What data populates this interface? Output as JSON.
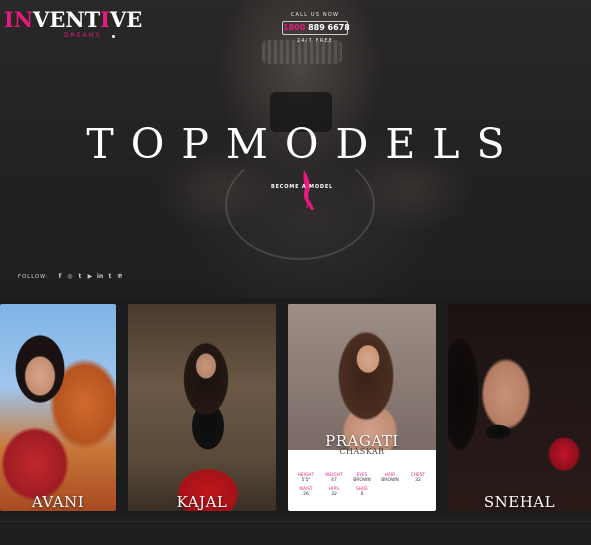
{
  "brand": {
    "name_prefix": "IN",
    "name_rest": "VENT",
    "name_i": "I",
    "name_end": "VE",
    "tagline": "DREAMS"
  },
  "contact": {
    "call_label": "CALL US NOW",
    "phone_prefix": "1800",
    "phone_number": "889 6678",
    "availability": "24/7 FREE"
  },
  "hero": {
    "title": "TOPMODELS",
    "cta": "BECOME A MODEL"
  },
  "follow": {
    "label": "FOLLOW:",
    "icons": [
      "facebook-icon",
      "instagram-icon",
      "twitter-icon",
      "youtube-icon",
      "linkedin-icon",
      "tumblr-icon",
      "pinterest-icon"
    ],
    "glyphs": [
      "f",
      "◎",
      "t",
      "▶",
      "in",
      "t",
      "℗"
    ]
  },
  "models": [
    {
      "name": "AVANI"
    },
    {
      "name": "KAJAL"
    },
    {
      "name": "PRAGATI",
      "surname": "CHASKAR",
      "stats": [
        {
          "label": "HEIGHT",
          "value": "5'5\""
        },
        {
          "label": "WEIGHT",
          "value": "47"
        },
        {
          "label": "EYES",
          "value": "BROWN"
        },
        {
          "label": "HAIR",
          "value": "BROWN"
        },
        {
          "label": "CHEST",
          "value": "32"
        },
        {
          "label": "WAIST",
          "value": "26"
        },
        {
          "label": "HIPS",
          "value": "32"
        },
        {
          "label": "SHOE",
          "value": "6"
        }
      ]
    },
    {
      "name": "SNEHAL"
    }
  ],
  "colors": {
    "accent": "#e8197e",
    "background": "#1b1b1b"
  }
}
